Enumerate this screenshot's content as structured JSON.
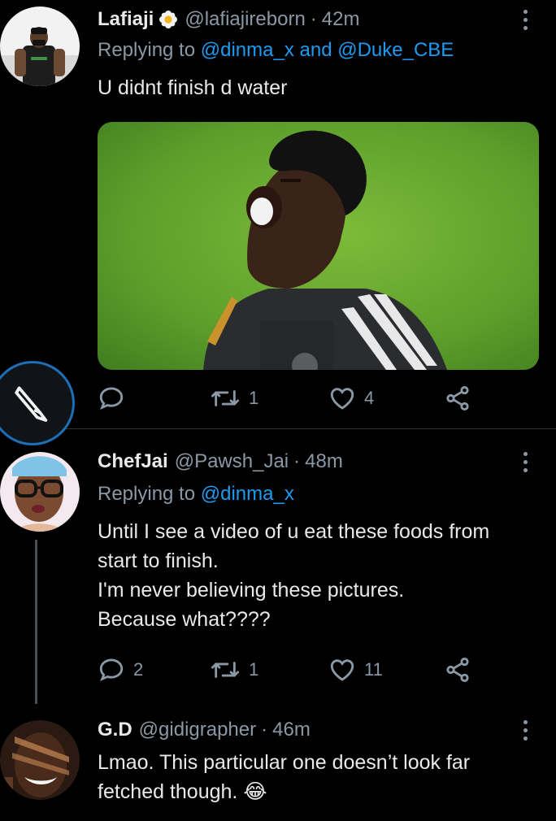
{
  "tweets": [
    {
      "name": "Lafiaji",
      "handle": "@lafiajireborn",
      "time": "42m",
      "replying_prefix": "Replying to ",
      "mention1": "@dinma_x",
      "joiner": " and ",
      "mention2": "@Duke_CBE",
      "text_lines": [
        "U didnt finish d water"
      ],
      "actions": {
        "reply": "",
        "retweet": "1",
        "like": "4"
      }
    },
    {
      "name": "ChefJai",
      "handle": "@Pawsh_Jai",
      "time": "48m",
      "replying_prefix": "Replying to ",
      "mention1": "@dinma_x",
      "text_lines": [
        "Until I see a video of u eat these foods from",
        "start to finish.",
        "I'm never believing these pictures.",
        "Because what????"
      ],
      "actions": {
        "reply": "2",
        "retweet": "1",
        "like": "11"
      }
    },
    {
      "name": "G.D",
      "handle": "@gidigrapher",
      "time": "46m",
      "text_lines": [
        "Lmao. This particular one doesn’t look far",
        "fetched though."
      ],
      "emoji": "😂"
    }
  ],
  "separator": "·",
  "icons": {
    "more": "more-vertical-icon",
    "reply": "reply-icon",
    "retweet": "retweet-icon",
    "like": "heart-icon",
    "share": "share-icon",
    "compose": "pencil-icon",
    "verified_flower": "flower-icon"
  },
  "colors": {
    "background": "#000000",
    "text": "#e7e9ea",
    "muted": "#8b98a5",
    "link": "#1d9bf0",
    "divider": "#2f3336",
    "fab_border": "#1d6fb8"
  }
}
